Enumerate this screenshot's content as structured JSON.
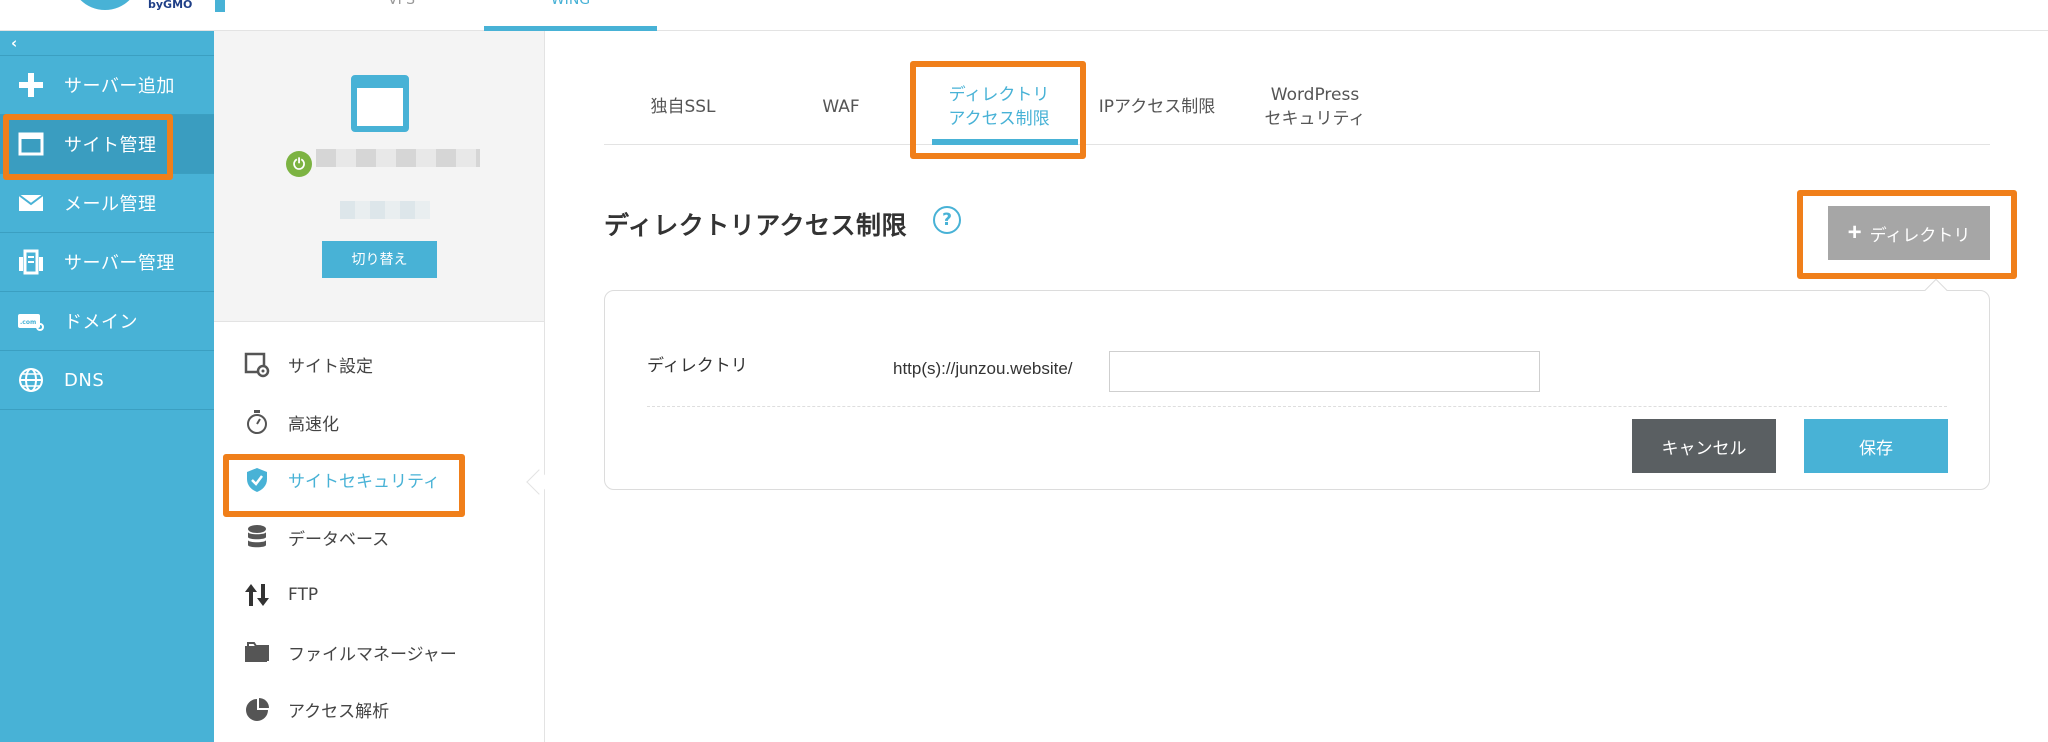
{
  "header": {
    "logo_text": "byGMO",
    "tabs": [
      {
        "label": "VPS"
      },
      {
        "label": "WING"
      }
    ]
  },
  "sidebar": {
    "collapse_glyph": "‹",
    "items": [
      {
        "label": "サーバー追加",
        "icon": "plus-icon"
      },
      {
        "label": "サイト管理",
        "icon": "window-icon"
      },
      {
        "label": "メール管理",
        "icon": "mail-icon"
      },
      {
        "label": "サーバー管理",
        "icon": "server-icon"
      },
      {
        "label": "ドメイン",
        "icon": "domain-icon"
      },
      {
        "label": "DNS",
        "icon": "globe-icon"
      }
    ]
  },
  "site_panel": {
    "switch_label": "切り替え"
  },
  "site_menu": {
    "items": [
      {
        "label": "サイト設定",
        "icon": "settings-icon"
      },
      {
        "label": "高速化",
        "icon": "stopwatch-icon"
      },
      {
        "label": "サイトセキュリティ",
        "icon": "shield-icon"
      },
      {
        "label": "データベース",
        "icon": "database-icon"
      },
      {
        "label": "FTP",
        "icon": "transfer-icon"
      },
      {
        "label": "ファイルマネージャー",
        "icon": "folder-icon"
      },
      {
        "label": "アクセス解析",
        "icon": "pie-chart-icon"
      }
    ]
  },
  "security_tabs": {
    "items": [
      {
        "label": "独自SSL"
      },
      {
        "label": "WAF"
      },
      {
        "line1": "ディレクトリ",
        "line2": "アクセス制限"
      },
      {
        "label": "IPアクセス制限"
      },
      {
        "line1": "WordPress",
        "line2": "セキュリティ"
      }
    ]
  },
  "main": {
    "title": "ディレクトリアクセス制限",
    "help_glyph": "?",
    "add_button": "ディレクトリ",
    "form": {
      "label": "ディレクトリ",
      "url_prefix": "http(s)://junzou.website/",
      "input_value": "",
      "cancel": "キャンセル",
      "save": "保存"
    }
  },
  "colors": {
    "accent": "#48b2d6",
    "highlight": "#f07f1a",
    "cancel": "#5a5f62",
    "disabled": "#a6a6a6"
  }
}
